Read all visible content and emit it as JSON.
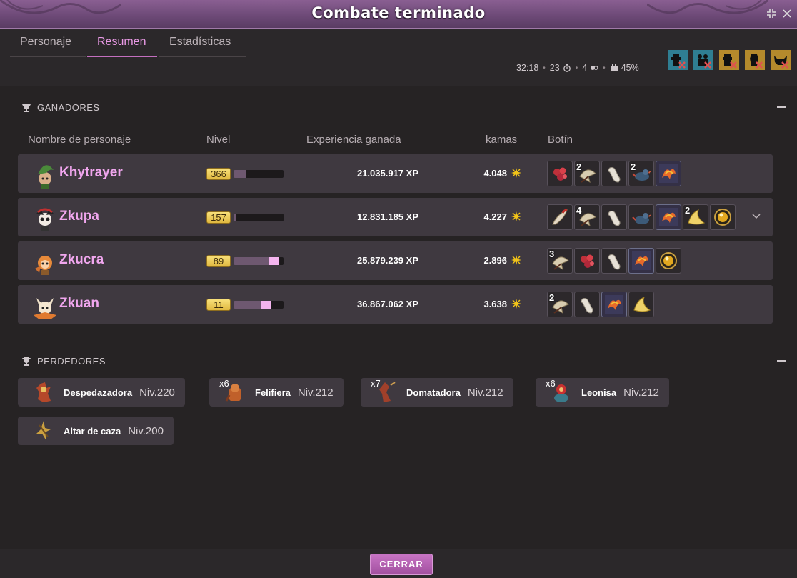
{
  "window": {
    "title": "Combate terminado"
  },
  "tabs": [
    {
      "label": "Personaje"
    },
    {
      "label": "Resumen"
    },
    {
      "label": "Estadísticas"
    }
  ],
  "fight_info": {
    "duration": "32:18",
    "turns": "23",
    "players": "4",
    "bonus": "45%"
  },
  "winners": {
    "heading": "GANADORES",
    "columns": {
      "name": "Nombre de personaje",
      "level": "Nivel",
      "xp": "Experiencia ganada",
      "kamas": "kamas",
      "loot": "Botín"
    },
    "rows": [
      {
        "name": "Khytrayer",
        "level": "366",
        "level_progress": 0.25,
        "xp": "21.035.917",
        "kamas": "4.048",
        "loot": [
          {
            "icon": "red-berries-icon",
            "qty": ""
          },
          {
            "icon": "fan-icon",
            "qty": "2"
          },
          {
            "icon": "bone-icon",
            "qty": ""
          },
          {
            "icon": "bird-icon",
            "qty": "2"
          },
          {
            "icon": "phoenix-card-icon",
            "qty": ""
          }
        ]
      },
      {
        "name": "Zkupa",
        "level": "157",
        "level_progress": 0.06,
        "xp": "12.831.185",
        "kamas": "4.227",
        "loot": [
          {
            "icon": "feather-icon",
            "qty": ""
          },
          {
            "icon": "fan-icon",
            "qty": "4"
          },
          {
            "icon": "bone-icon",
            "qty": ""
          },
          {
            "icon": "bird-icon",
            "qty": ""
          },
          {
            "icon": "phoenix-card-icon",
            "qty": ""
          },
          {
            "icon": "horn-icon",
            "qty": "2"
          },
          {
            "icon": "orb-icon",
            "qty": ""
          }
        ]
      },
      {
        "name": "Zkucra",
        "level": "89",
        "level_progress": 0.92,
        "xp": "25.879.239",
        "kamas": "2.896",
        "loot": [
          {
            "icon": "fan-icon",
            "qty": "3"
          },
          {
            "icon": "red-berries-icon",
            "qty": ""
          },
          {
            "icon": "bone-icon",
            "qty": ""
          },
          {
            "icon": "phoenix-card-icon",
            "qty": ""
          },
          {
            "icon": "orb-icon",
            "qty": ""
          }
        ]
      },
      {
        "name": "Zkuan",
        "level": "11",
        "level_progress": 0.75,
        "xp": "36.867.062",
        "kamas": "3.638",
        "loot": [
          {
            "icon": "fan-icon",
            "qty": "2"
          },
          {
            "icon": "bone-icon",
            "qty": ""
          },
          {
            "icon": "phoenix-card-icon",
            "qty": ""
          },
          {
            "icon": "horn-icon",
            "qty": ""
          }
        ]
      }
    ],
    "xp_unit": "XP"
  },
  "losers": {
    "heading": "PERDEDORES",
    "items": [
      {
        "name": "Despedazadora",
        "level": "Niv.220",
        "qty": ""
      },
      {
        "name": "Felifiera",
        "level": "Niv.212",
        "qty": "x6"
      },
      {
        "name": "Domatadora",
        "level": "Niv.212",
        "qty": "x7"
      },
      {
        "name": "Leonisa",
        "level": "Niv.212",
        "qty": "x6"
      },
      {
        "name": "Altar de caza",
        "level": "Niv.200",
        "qty": ""
      }
    ]
  },
  "footer": {
    "close_label": "CERRAR"
  },
  "colors": {
    "accent": "#c46fc0",
    "name": "#f0a6ee",
    "panel": "#3f3940"
  }
}
